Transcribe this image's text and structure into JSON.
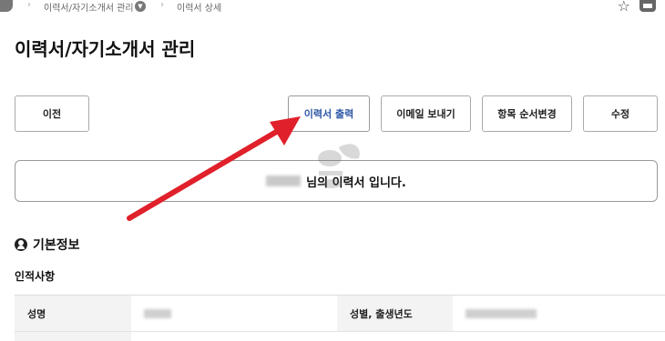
{
  "breadcrumb": {
    "items": [
      "이력서/자기소개서 관리",
      "이력서 상세"
    ]
  },
  "page": {
    "title": "이력서/자기소개서 관리"
  },
  "toolbar": {
    "prev": "이전",
    "print": "이력서 출력",
    "email": "이메일 보내기",
    "order": "항목 순서변경",
    "edit": "수정"
  },
  "notice": {
    "suffix": "님의 이력서 입니다."
  },
  "basic_info": {
    "title": "기본정보",
    "subtitle": "인적사항",
    "fields": [
      {
        "label": "성명"
      },
      {
        "label": "성별, 출생년도"
      }
    ]
  },
  "colors": {
    "accent": "#2c56a6",
    "arrow": "#e0202a",
    "label_bg": "#f3f3f3"
  },
  "icons": [
    "home-icon",
    "chevron-right-icon",
    "dropdown-icon",
    "star-icon",
    "print-icon",
    "user-circle-icon"
  ]
}
